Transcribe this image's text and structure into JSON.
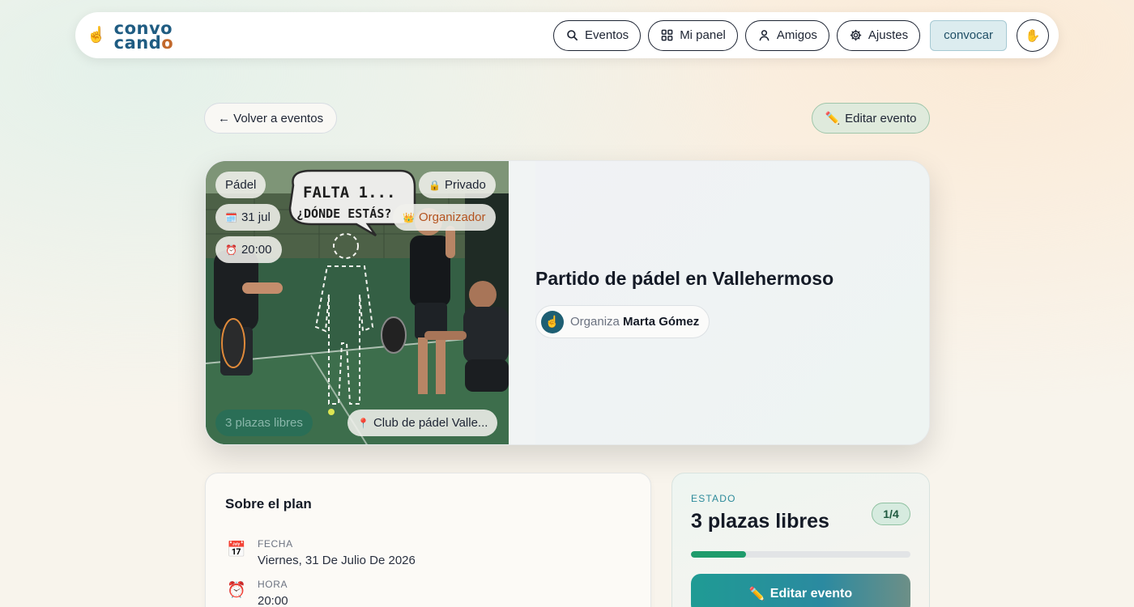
{
  "app": {
    "logo_top": "convo",
    "logo_bot_prefix": "cand",
    "logo_bot_suffix": "o",
    "logo_icon": "pointing-hand-icon"
  },
  "nav": {
    "items": [
      {
        "label": "Eventos",
        "icon": "search-icon"
      },
      {
        "label": "Mi panel",
        "icon": "grid-icon"
      },
      {
        "label": "Amigos",
        "icon": "user-icon"
      },
      {
        "label": "Ajustes",
        "icon": "gear-icon"
      }
    ],
    "convocar_label": "convocar",
    "avatar_icon": "raised-hand-icon"
  },
  "actions": {
    "back_label": "← Volver a eventos",
    "edit_label": "Editar evento"
  },
  "event": {
    "title": "Partido de pádel en Vallehermoso",
    "organizer_prefix": "Organiza",
    "organizer_name": "Marta Gómez",
    "image_caption_line1": "FALTA 1...",
    "image_caption_line2": "¿DÓNDE ESTÁS?",
    "tags": {
      "sport": "Pádel",
      "privacy": "Privado",
      "role": "Organizador",
      "date": "31 jul",
      "time": "20:00",
      "free": "3 plazas libres",
      "location": "Club de pádel Valle..."
    }
  },
  "about": {
    "title": "Sobre el plan",
    "date_label": "FECHA",
    "date_value": "Viernes, 31 De Julio De 2026",
    "time_label": "HORA",
    "time_value": "20:00"
  },
  "estado": {
    "label": "ESTADO",
    "value": "3 plazas libres",
    "count": "1/4",
    "progress_fraction": 0.25,
    "edit_label": "Editar evento"
  },
  "colors": {
    "accent": "#1e9b6b",
    "brand": "#1f5c82",
    "organizer": "#b4531f"
  }
}
